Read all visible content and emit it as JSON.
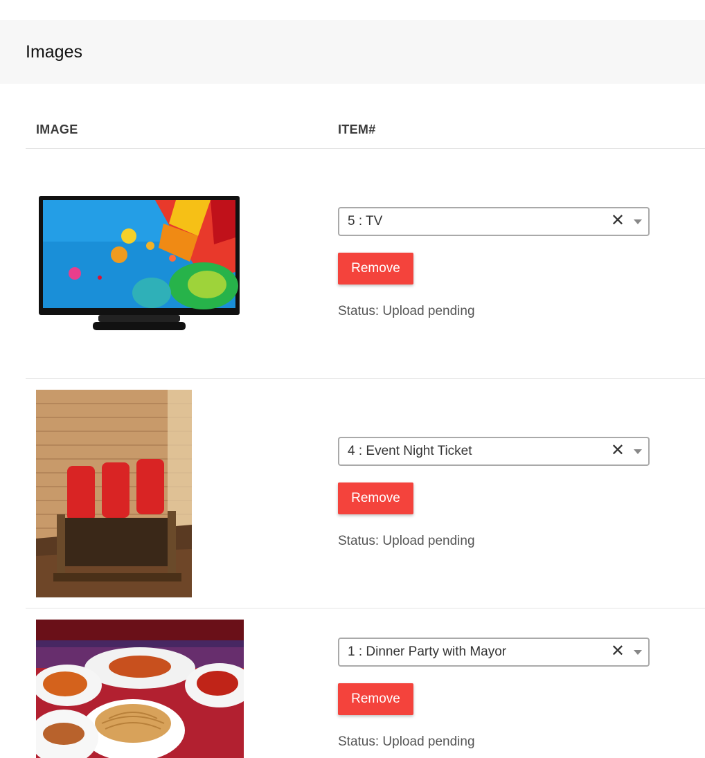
{
  "panel": {
    "title": "Images"
  },
  "table": {
    "headers": {
      "image": "IMAGE",
      "item": "ITEM#"
    },
    "rows": [
      {
        "image_icon": "tv-photo",
        "item_value": "5 : TV",
        "remove_label": "Remove",
        "status": "Status: Upload pending"
      },
      {
        "image_icon": "theater-seats-photo",
        "item_value": "4 : Event Night Ticket",
        "remove_label": "Remove",
        "status": "Status: Upload pending"
      },
      {
        "image_icon": "dinner-food-photo",
        "item_value": "1 : Dinner Party with Mayor",
        "remove_label": "Remove",
        "status": "Status: Upload pending"
      }
    ]
  },
  "colors": {
    "remove_button": "#f4433c",
    "header_bg": "#f7f7f7",
    "border": "#e4e4e4"
  },
  "clear_glyph": "✕"
}
